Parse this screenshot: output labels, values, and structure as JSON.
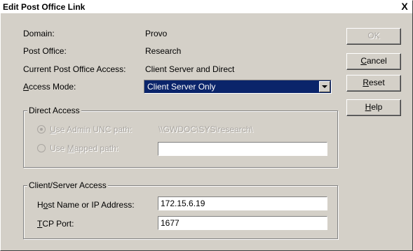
{
  "window": {
    "title": "Edit Post Office Link",
    "close_glyph": "X"
  },
  "info": {
    "domain_label": "Domain:",
    "domain_value": "Provo",
    "po_label": "Post Office:",
    "po_value": "Research",
    "access_label": "Current Post Office Access:",
    "access_value": "Client Server and Direct",
    "mode_label_pre": "A",
    "mode_label_post": "ccess Mode:",
    "mode_value": "Client Server Only"
  },
  "direct": {
    "legend": "Direct Access",
    "unc_pre": "U",
    "unc_post": "se Admin UNC path:",
    "unc_value": "\\\\GWDOC\\SYS\\research\\",
    "mapped_pre": "Use ",
    "mapped_key": "M",
    "mapped_post": "apped path:",
    "mapped_value": ""
  },
  "cs": {
    "legend": "Client/Server Access",
    "host_pre": "H",
    "host_key": "o",
    "host_post": "st Name or IP Address:",
    "host_value": "172.15.6.19",
    "port_key": "T",
    "port_post": "CP Port:",
    "port_value": "1677"
  },
  "buttons": {
    "ok": "OK",
    "cancel_key": "C",
    "cancel_rest": "ancel",
    "reset_key": "R",
    "reset_rest": "eset",
    "help_key": "H",
    "help_rest": "elp"
  },
  "colors": {
    "selection": "#0a246a",
    "face": "#d4d0c8",
    "disabled_text": "#a9a5a0"
  }
}
